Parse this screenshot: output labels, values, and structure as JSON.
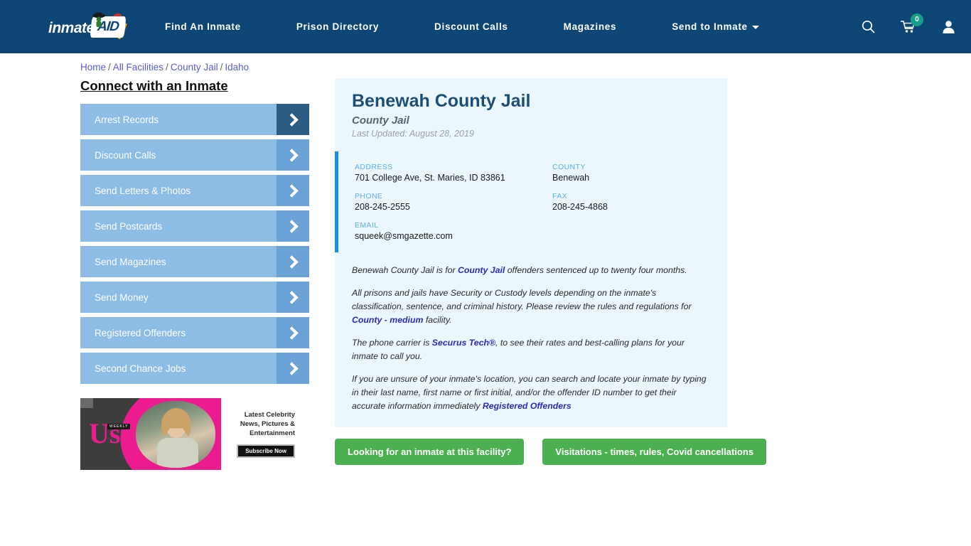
{
  "header": {
    "logo_text": "inmate",
    "logo_badge": "AID",
    "nav": [
      {
        "label": "Find An Inmate",
        "has_caret": false
      },
      {
        "label": "Prison Directory",
        "has_caret": false
      },
      {
        "label": "Discount Calls",
        "has_caret": false
      },
      {
        "label": "Magazines",
        "has_caret": false
      },
      {
        "label": "Send to Inmate",
        "has_caret": true
      }
    ],
    "icons": {
      "search": "search-icon",
      "cart": "cart-icon",
      "cart_count": "0",
      "account": "user-icon"
    },
    "bg_color": "#0d4674",
    "badge_color": "#16a085"
  },
  "breadcrumb": {
    "items": [
      "Home",
      "All Facilities",
      "County Jail",
      "Idaho"
    ],
    "separator": "/"
  },
  "sidebar": {
    "title": "Connect with an Inmate",
    "items": [
      {
        "label": "Arrest Records"
      },
      {
        "label": "Discount Calls"
      },
      {
        "label": "Send Letters & Photos"
      },
      {
        "label": "Send Postcards"
      },
      {
        "label": "Send Magazines"
      },
      {
        "label": "Send Money"
      },
      {
        "label": "Registered Offenders"
      },
      {
        "label": "Second Chance Jobs"
      }
    ],
    "item_bg": "#8dbce5",
    "arrow_bg": "#6ba3d6",
    "arrow_bg_active": "#2d5c82"
  },
  "ad": {
    "brand": "Us",
    "brand_sub": "WEEKLY",
    "line1": "Latest Celebrity",
    "line2": "News, Pictures &",
    "line3": "Entertainment",
    "button": "Subscribe Now"
  },
  "facility": {
    "name": "Benewah County Jail",
    "type": "County Jail",
    "last_updated": "Last Updated: August 28, 2019",
    "fields": [
      {
        "label": "ADDRESS",
        "value": "701 College Ave, St. Maries, ID 83861"
      },
      {
        "label": "COUNTY",
        "value": "Benewah"
      },
      {
        "label": "PHONE",
        "value": "208-245-2555"
      },
      {
        "label": "FAX",
        "value": "208-245-4868"
      },
      {
        "label": "EMAIL",
        "value": "squeek@smgazette.com"
      }
    ],
    "accent_color": "#1291ea",
    "panel_bg": "#ecf7fd"
  },
  "description": {
    "p1_a": "Benewah County Jail is for ",
    "p1_link": "County Jail",
    "p1_b": " offenders sentenced up to twenty four months.",
    "p2_a": "All prisons and jails have Security or Custody levels depending on the inmate's classification, sentence, and criminal history. Please review the rules and regulations for ",
    "p2_link": "County - medium",
    "p2_b": " facility.",
    "p3_a": "The phone carrier is ",
    "p3_link": "Securus Tech®",
    "p3_b": ", to see their rates and best-calling plans for your inmate to call you.",
    "p4_a": "If you are unsure of your inmate's location, you can search and locate your inmate by typing in their last name, first name or first initial, and/or the offender ID number to get their accurate information immediately ",
    "p4_link": "Registered Offenders"
  },
  "cta": {
    "primary": "Looking for an inmate at this facility?",
    "secondary": "Visitations - times, rules, Covid cancellations",
    "color": "#4caf50"
  }
}
